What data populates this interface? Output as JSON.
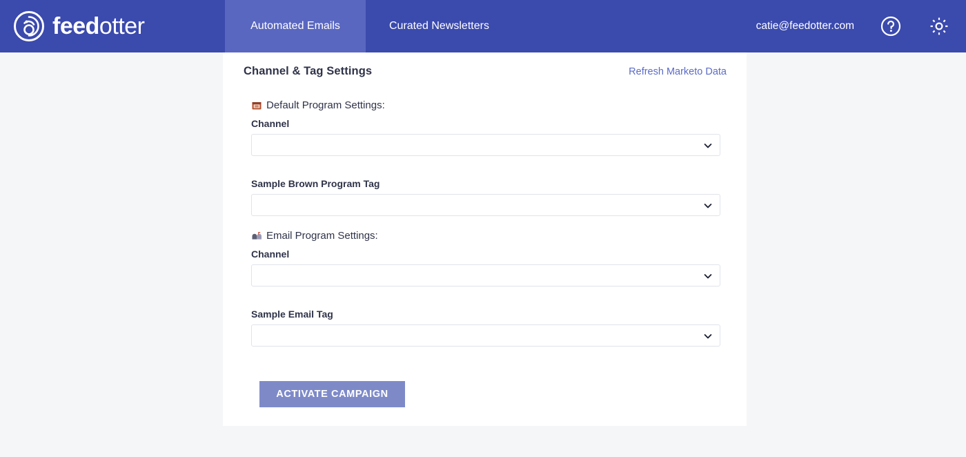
{
  "header": {
    "logo": {
      "icon_name": "feedotter-otter-logo-icon",
      "text_bold": "feed",
      "text_light": "otter"
    },
    "tabs": [
      {
        "label": "Automated Emails",
        "active": true
      },
      {
        "label": "Curated Newsletters",
        "active": false
      }
    ],
    "user_email": "catie@feedotter.com",
    "help_icon": "question-mark-circle-icon",
    "settings_icon": "gear-icon",
    "background_color": "#3b4aad",
    "active_tab_color": "#5a67c0"
  },
  "card": {
    "title": "Channel & Tag Settings",
    "refresh_link": "Refresh Marketo Data",
    "sections": [
      {
        "icon_name": "marketo-default-program-icon",
        "heading": "Default Program Settings:",
        "fields": [
          {
            "label": "Channel",
            "value": "",
            "control": "select",
            "chevron_icon": "chevron-down-icon"
          },
          {
            "label": "Sample Brown Program Tag",
            "value": "",
            "control": "select",
            "chevron_icon": "chevron-down-icon"
          }
        ]
      },
      {
        "icon_name": "marketo-email-program-icon",
        "heading": "Email Program Settings:",
        "fields": [
          {
            "label": "Channel",
            "value": "",
            "control": "select",
            "chevron_icon": "chevron-down-icon"
          },
          {
            "label": "Sample Email Tag",
            "value": "",
            "control": "select",
            "chevron_icon": "chevron-down-icon"
          }
        ]
      }
    ],
    "activate_button": "ACTIVATE CAMPAIGN",
    "activate_button_color": "#7e8ac8",
    "link_color": "#5b6bc8",
    "page_background": "#f5f6f8"
  }
}
